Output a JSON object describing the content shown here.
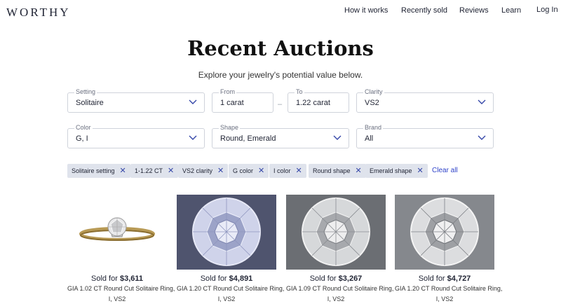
{
  "nav": {
    "logo": "WORTHY",
    "links": [
      "How it works",
      "Recently sold",
      "Reviews",
      "Learn"
    ],
    "login": "Log In"
  },
  "hero": {
    "title": "Recent Auctions",
    "subtitle": "Explore your jewelry's potential value below."
  },
  "filters": {
    "setting": {
      "label": "Setting",
      "value": "Solitaire"
    },
    "from": {
      "label": "From",
      "value": "1  carat"
    },
    "to": {
      "label": "To",
      "value": "1.22  carat"
    },
    "dash": "–",
    "clarity": {
      "label": "Clarity",
      "value": "VS2"
    },
    "color": {
      "label": "Color",
      "value": "G, I"
    },
    "shape": {
      "label": "Shape",
      "value": "Round, Emerald"
    },
    "brand": {
      "label": "Brand",
      "value": "All"
    }
  },
  "chips": [
    "Solitaire setting",
    "1-1.22 CT",
    "VS2 clarity",
    "G color",
    "I color",
    "Round shape",
    "Emerald shape"
  ],
  "chip_remove_glyph": "✕",
  "clear_all": "Clear all",
  "cards": [
    {
      "sold_prefix": "Sold for ",
      "price": "$3,611",
      "line1": "GIA 1.02 CT Round Cut Solitaire Ring,",
      "line2": "I, VS2"
    },
    {
      "sold_prefix": "Sold for ",
      "price": "$4,891",
      "line1": "GIA 1.20 CT Round Cut Solitaire Ring,",
      "line2": "I, VS2"
    },
    {
      "sold_prefix": "Sold for ",
      "price": "$3,267",
      "line1": "GIA 1.09 CT Round Cut Solitaire Ring,",
      "line2": "I, VS2"
    },
    {
      "sold_prefix": "Sold for ",
      "price": "$4,727",
      "line1": "GIA 1.20 CT Round Cut Solitaire Ring,",
      "line2": "I, VS2"
    }
  ],
  "colors": {
    "accent": "#2f43c9",
    "chip_bg": "#dfe3ec",
    "border": "#cfd3db"
  }
}
